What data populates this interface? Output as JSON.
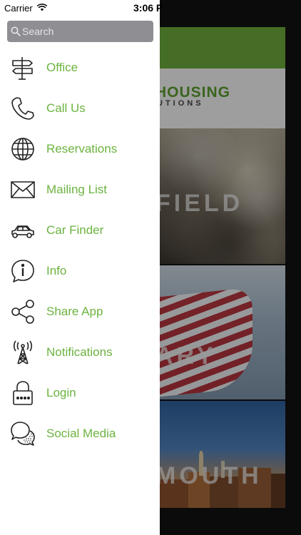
{
  "status_bar": {
    "carrier": "Carrier",
    "time": "3:06 P"
  },
  "search": {
    "placeholder": "Search"
  },
  "menu": {
    "items": [
      {
        "label": "Office",
        "icon": "signpost-icon"
      },
      {
        "label": "Call Us",
        "icon": "phone-icon"
      },
      {
        "label": "Reservations",
        "icon": "globe-icon"
      },
      {
        "label": "Mailing List",
        "icon": "envelope-icon"
      },
      {
        "label": "Car Finder",
        "icon": "car-icon"
      },
      {
        "label": "Info",
        "icon": "info-icon"
      },
      {
        "label": "Share App",
        "icon": "share-icon"
      },
      {
        "label": "Notifications",
        "icon": "broadcast-tower-icon"
      },
      {
        "label": "Login",
        "icon": "lock-icon"
      },
      {
        "label": "Social Media",
        "icon": "chat-bubbles-icon"
      }
    ]
  },
  "background_app": {
    "logo_main": "HOUSING",
    "logo_sub": "UTIONS",
    "tiles": [
      {
        "label": "FIELD"
      },
      {
        "label": "ARY"
      },
      {
        "label": "MOUTH"
      }
    ]
  },
  "colors": {
    "accent_green": "#6cb33f",
    "header_green": "#6aa83a",
    "search_bg": "#8e8e93"
  }
}
